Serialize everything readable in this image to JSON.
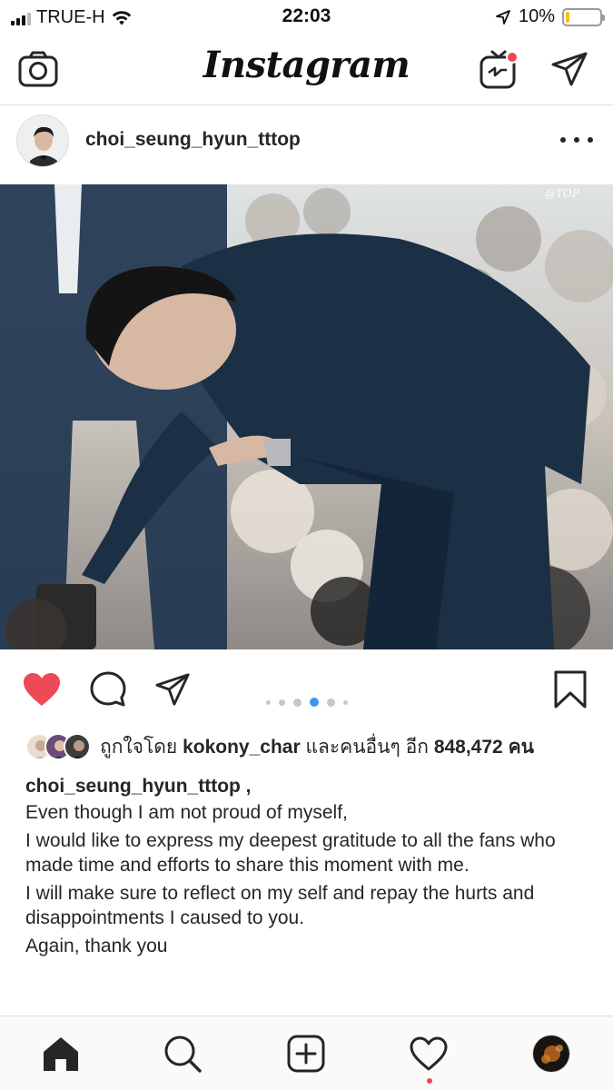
{
  "status_bar": {
    "carrier": "TRUE-H",
    "time": "22:03",
    "battery": "10%",
    "battery_level": 0.1
  },
  "header": {
    "logo": "Instagram",
    "camera_icon": "camera-icon",
    "igtv_icon": "igtv-icon",
    "direct_icon": "paper-plane-icon"
  },
  "post": {
    "username": "choi_seung_hyun_tttop",
    "more_icon": "ellipsis-icon",
    "image_watermark": "@TOP",
    "carousel": {
      "count": 6,
      "active": 4
    },
    "liked": true,
    "likes": {
      "prefix": "ถูกใจโดย",
      "user": "kokony_char",
      "middle": "และคนอื่นๆ อีก",
      "count": "848,472",
      "suffix": "คน"
    },
    "caption": {
      "username": "choi_seung_hyun_tttop ,",
      "lines": [
        "Even though I am not proud of myself,",
        "I would like to express my deepest gratitude to all the fans who made time and efforts to share this moment with me.",
        "I will make sure to reflect on my self and repay the hurts and disappointments I caused to you.",
        "Again, thank you"
      ]
    }
  },
  "colors": {
    "heart": "#ed4956",
    "active_dot": "#3897f0",
    "border": "#dbdbdb",
    "text": "#262626"
  },
  "bottom_nav": [
    "home-icon",
    "search-icon",
    "add-post-icon",
    "activity-heart-icon",
    "profile-avatar"
  ]
}
